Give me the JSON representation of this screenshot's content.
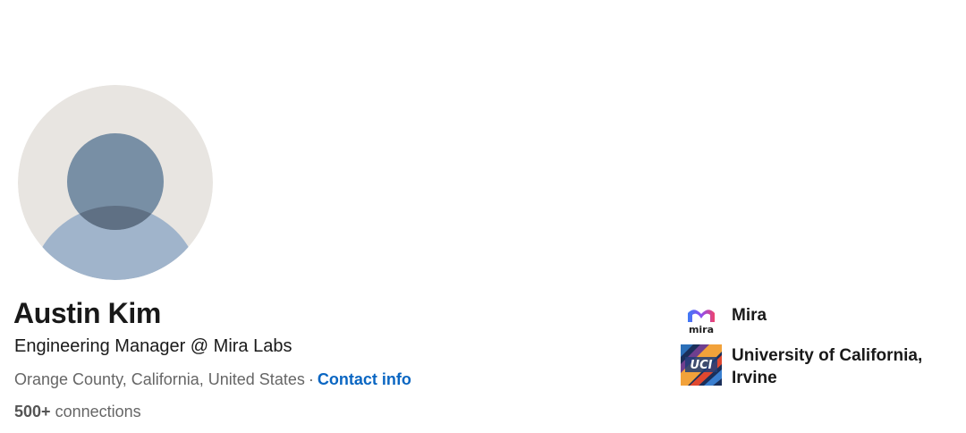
{
  "profile": {
    "name": "Austin Kim",
    "headline": "Engineering Manager @ Mira Labs",
    "location": "Orange County, California, United States",
    "separator": "·",
    "contact_info_label": "Contact info",
    "connections_count": "500+",
    "connections_label": "connections",
    "avatar_icon": "default-person-avatar-icon"
  },
  "organizations": {
    "company": {
      "name": "Mira",
      "logo_text": "mira",
      "logo_icon": "mira-logo-icon"
    },
    "school": {
      "name": "University of California, Irvine",
      "logo_text": "UCI",
      "logo_icon": "uci-logo-icon"
    }
  },
  "colors": {
    "link": "#0a66c2",
    "text_primary": "#191919",
    "text_secondary": "#666666",
    "avatar_bg": "#e8e5e1",
    "avatar_head": "#788fa5",
    "avatar_body": "#a0b4cb"
  }
}
